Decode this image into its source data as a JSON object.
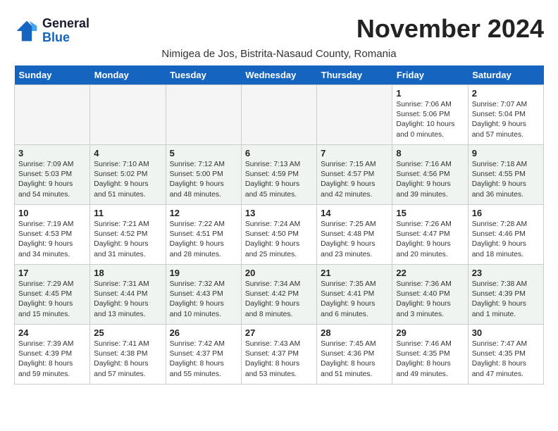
{
  "header": {
    "logo_line1": "General",
    "logo_line2": "Blue",
    "month_title": "November 2024",
    "subtitle": "Nimigea de Jos, Bistrita-Nasaud County, Romania"
  },
  "weekdays": [
    "Sunday",
    "Monday",
    "Tuesday",
    "Wednesday",
    "Thursday",
    "Friday",
    "Saturday"
  ],
  "weeks": [
    [
      {
        "day": "",
        "info": "",
        "empty": true
      },
      {
        "day": "",
        "info": "",
        "empty": true
      },
      {
        "day": "",
        "info": "",
        "empty": true
      },
      {
        "day": "",
        "info": "",
        "empty": true
      },
      {
        "day": "",
        "info": "",
        "empty": true
      },
      {
        "day": "1",
        "info": "Sunrise: 7:06 AM\nSunset: 5:06 PM\nDaylight: 10 hours\nand 0 minutes.",
        "empty": false
      },
      {
        "day": "2",
        "info": "Sunrise: 7:07 AM\nSunset: 5:04 PM\nDaylight: 9 hours\nand 57 minutes.",
        "empty": false
      }
    ],
    [
      {
        "day": "3",
        "info": "Sunrise: 7:09 AM\nSunset: 5:03 PM\nDaylight: 9 hours\nand 54 minutes.",
        "empty": false
      },
      {
        "day": "4",
        "info": "Sunrise: 7:10 AM\nSunset: 5:02 PM\nDaylight: 9 hours\nand 51 minutes.",
        "empty": false
      },
      {
        "day": "5",
        "info": "Sunrise: 7:12 AM\nSunset: 5:00 PM\nDaylight: 9 hours\nand 48 minutes.",
        "empty": false
      },
      {
        "day": "6",
        "info": "Sunrise: 7:13 AM\nSunset: 4:59 PM\nDaylight: 9 hours\nand 45 minutes.",
        "empty": false
      },
      {
        "day": "7",
        "info": "Sunrise: 7:15 AM\nSunset: 4:57 PM\nDaylight: 9 hours\nand 42 minutes.",
        "empty": false
      },
      {
        "day": "8",
        "info": "Sunrise: 7:16 AM\nSunset: 4:56 PM\nDaylight: 9 hours\nand 39 minutes.",
        "empty": false
      },
      {
        "day": "9",
        "info": "Sunrise: 7:18 AM\nSunset: 4:55 PM\nDaylight: 9 hours\nand 36 minutes.",
        "empty": false
      }
    ],
    [
      {
        "day": "10",
        "info": "Sunrise: 7:19 AM\nSunset: 4:53 PM\nDaylight: 9 hours\nand 34 minutes.",
        "empty": false
      },
      {
        "day": "11",
        "info": "Sunrise: 7:21 AM\nSunset: 4:52 PM\nDaylight: 9 hours\nand 31 minutes.",
        "empty": false
      },
      {
        "day": "12",
        "info": "Sunrise: 7:22 AM\nSunset: 4:51 PM\nDaylight: 9 hours\nand 28 minutes.",
        "empty": false
      },
      {
        "day": "13",
        "info": "Sunrise: 7:24 AM\nSunset: 4:50 PM\nDaylight: 9 hours\nand 25 minutes.",
        "empty": false
      },
      {
        "day": "14",
        "info": "Sunrise: 7:25 AM\nSunset: 4:48 PM\nDaylight: 9 hours\nand 23 minutes.",
        "empty": false
      },
      {
        "day": "15",
        "info": "Sunrise: 7:26 AM\nSunset: 4:47 PM\nDaylight: 9 hours\nand 20 minutes.",
        "empty": false
      },
      {
        "day": "16",
        "info": "Sunrise: 7:28 AM\nSunset: 4:46 PM\nDaylight: 9 hours\nand 18 minutes.",
        "empty": false
      }
    ],
    [
      {
        "day": "17",
        "info": "Sunrise: 7:29 AM\nSunset: 4:45 PM\nDaylight: 9 hours\nand 15 minutes.",
        "empty": false
      },
      {
        "day": "18",
        "info": "Sunrise: 7:31 AM\nSunset: 4:44 PM\nDaylight: 9 hours\nand 13 minutes.",
        "empty": false
      },
      {
        "day": "19",
        "info": "Sunrise: 7:32 AM\nSunset: 4:43 PM\nDaylight: 9 hours\nand 10 minutes.",
        "empty": false
      },
      {
        "day": "20",
        "info": "Sunrise: 7:34 AM\nSunset: 4:42 PM\nDaylight: 9 hours\nand 8 minutes.",
        "empty": false
      },
      {
        "day": "21",
        "info": "Sunrise: 7:35 AM\nSunset: 4:41 PM\nDaylight: 9 hours\nand 6 minutes.",
        "empty": false
      },
      {
        "day": "22",
        "info": "Sunrise: 7:36 AM\nSunset: 4:40 PM\nDaylight: 9 hours\nand 3 minutes.",
        "empty": false
      },
      {
        "day": "23",
        "info": "Sunrise: 7:38 AM\nSunset: 4:39 PM\nDaylight: 9 hours\nand 1 minute.",
        "empty": false
      }
    ],
    [
      {
        "day": "24",
        "info": "Sunrise: 7:39 AM\nSunset: 4:39 PM\nDaylight: 8 hours\nand 59 minutes.",
        "empty": false
      },
      {
        "day": "25",
        "info": "Sunrise: 7:41 AM\nSunset: 4:38 PM\nDaylight: 8 hours\nand 57 minutes.",
        "empty": false
      },
      {
        "day": "26",
        "info": "Sunrise: 7:42 AM\nSunset: 4:37 PM\nDaylight: 8 hours\nand 55 minutes.",
        "empty": false
      },
      {
        "day": "27",
        "info": "Sunrise: 7:43 AM\nSunset: 4:37 PM\nDaylight: 8 hours\nand 53 minutes.",
        "empty": false
      },
      {
        "day": "28",
        "info": "Sunrise: 7:45 AM\nSunset: 4:36 PM\nDaylight: 8 hours\nand 51 minutes.",
        "empty": false
      },
      {
        "day": "29",
        "info": "Sunrise: 7:46 AM\nSunset: 4:35 PM\nDaylight: 8 hours\nand 49 minutes.",
        "empty": false
      },
      {
        "day": "30",
        "info": "Sunrise: 7:47 AM\nSunset: 4:35 PM\nDaylight: 8 hours\nand 47 minutes.",
        "empty": false
      }
    ]
  ]
}
